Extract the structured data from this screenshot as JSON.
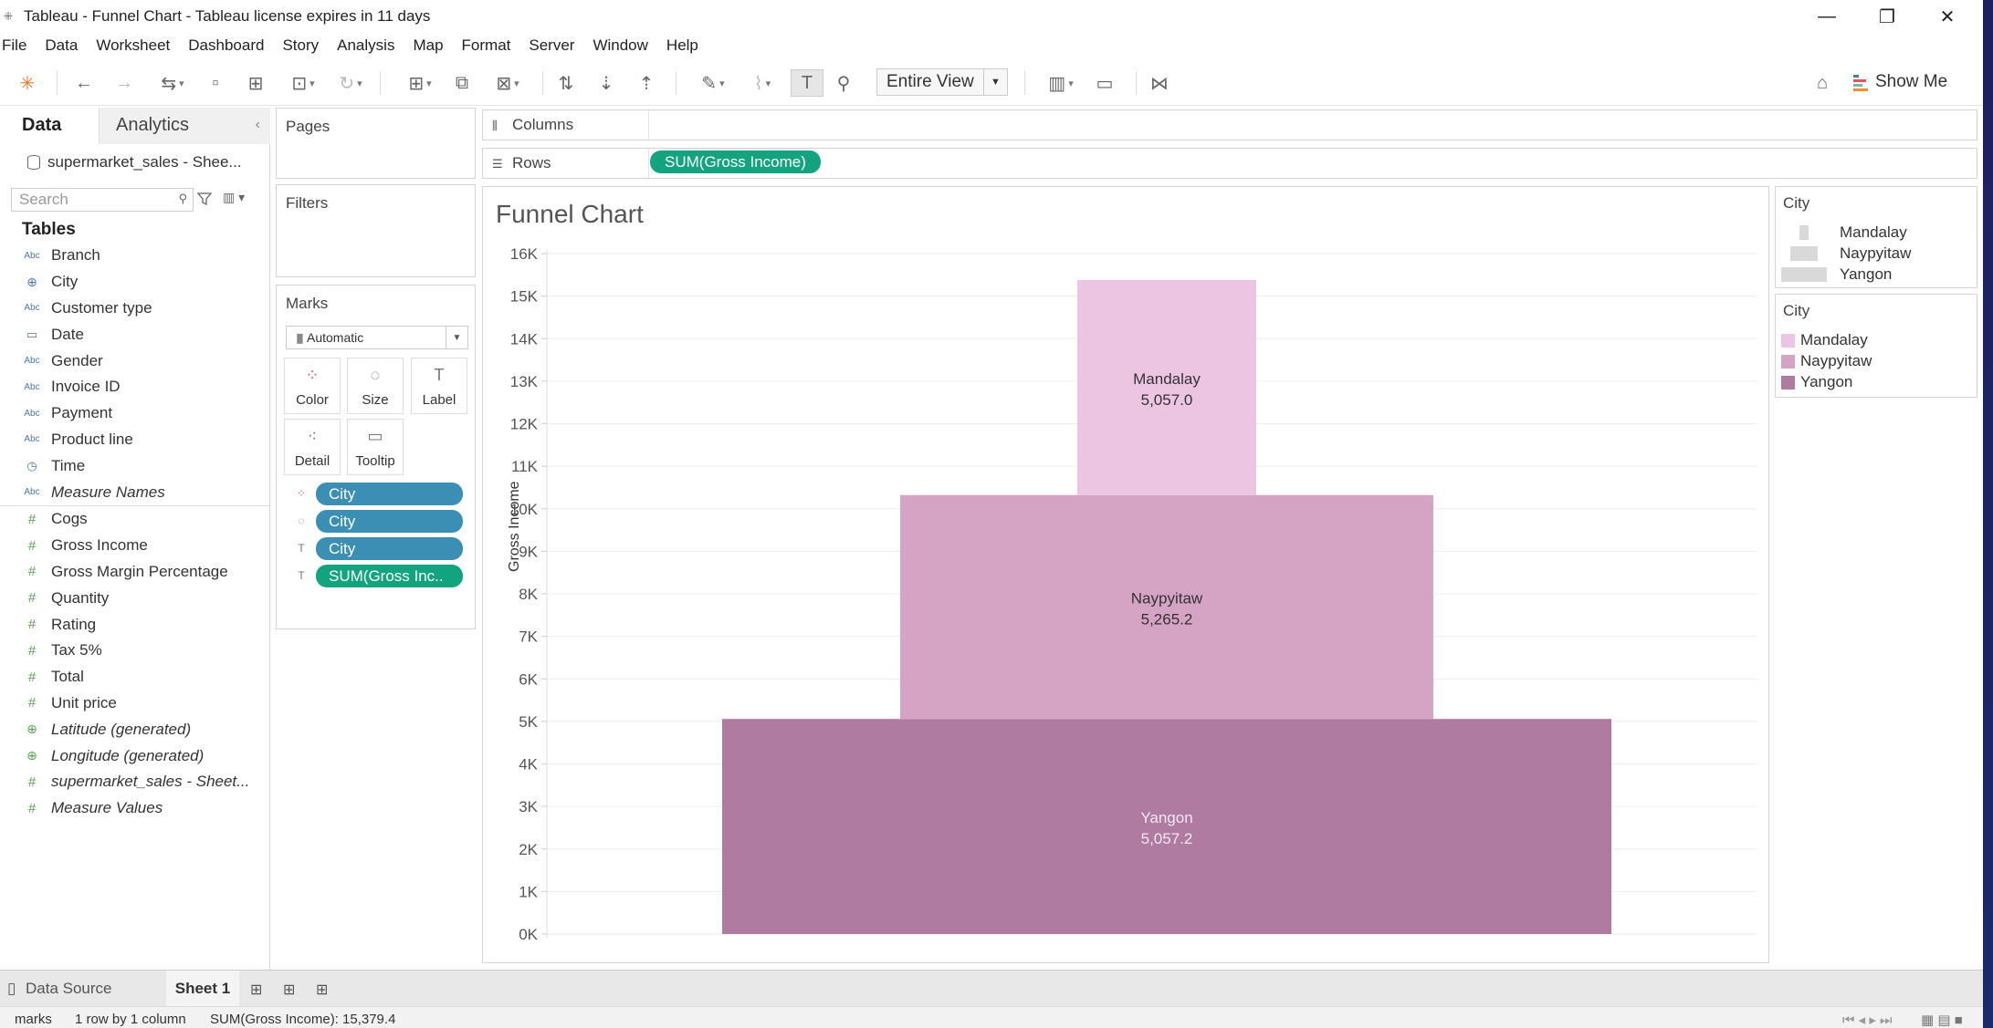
{
  "window": {
    "title": "Tableau - Funnel Chart - Tableau license expires in 11 days"
  },
  "menu": [
    "File",
    "Data",
    "Worksheet",
    "Dashboard",
    "Story",
    "Analysis",
    "Map",
    "Format",
    "Server",
    "Window",
    "Help"
  ],
  "toolbar": {
    "fit_select": "Entire View",
    "show_me": "Show Me"
  },
  "data_pane": {
    "tabs": [
      "Data",
      "Analytics"
    ],
    "datasource": "supermarket_sales - Shee...",
    "search_placeholder": "Search",
    "tables_heading": "Tables",
    "dimensions": [
      {
        "icon": "abc-icon",
        "glyph": "Abc",
        "label": "Branch",
        "italic": false
      },
      {
        "icon": "globe-icon",
        "glyph": "⊕",
        "label": "City",
        "italic": false
      },
      {
        "icon": "abc-icon",
        "glyph": "Abc",
        "label": "Customer type",
        "italic": false
      },
      {
        "icon": "calendar-icon",
        "glyph": "▭",
        "label": "Date",
        "italic": false
      },
      {
        "icon": "abc-icon",
        "glyph": "Abc",
        "label": "Gender",
        "italic": false
      },
      {
        "icon": "abc-icon",
        "glyph": "Abc",
        "label": "Invoice ID",
        "italic": false
      },
      {
        "icon": "abc-icon",
        "glyph": "Abc",
        "label": "Payment",
        "italic": false
      },
      {
        "icon": "abc-icon",
        "glyph": "Abc",
        "label": "Product line",
        "italic": false
      },
      {
        "icon": "clock-icon",
        "glyph": "◷",
        "label": "Time",
        "italic": false
      },
      {
        "icon": "abc-icon",
        "glyph": "Abc",
        "label": "Measure Names",
        "italic": true
      }
    ],
    "measures": [
      {
        "icon": "number-icon",
        "glyph": "#",
        "label": "Cogs",
        "italic": false
      },
      {
        "icon": "number-icon",
        "glyph": "#",
        "label": "Gross Income",
        "italic": false
      },
      {
        "icon": "number-icon",
        "glyph": "#",
        "label": "Gross Margin Percentage",
        "italic": false
      },
      {
        "icon": "number-icon",
        "glyph": "#",
        "label": "Quantity",
        "italic": false
      },
      {
        "icon": "number-icon",
        "glyph": "#",
        "label": "Rating",
        "italic": false
      },
      {
        "icon": "number-icon",
        "glyph": "#",
        "label": "Tax 5%",
        "italic": false
      },
      {
        "icon": "number-icon",
        "glyph": "#",
        "label": "Total",
        "italic": false
      },
      {
        "icon": "number-icon",
        "glyph": "#",
        "label": "Unit price",
        "italic": false
      },
      {
        "icon": "globe-icon",
        "glyph": "⊕",
        "label": "Latitude (generated)",
        "italic": true
      },
      {
        "icon": "globe-icon",
        "glyph": "⊕",
        "label": "Longitude (generated)",
        "italic": true
      },
      {
        "icon": "number-icon",
        "glyph": "#",
        "label": "supermarket_sales - Sheet...",
        "italic": true
      },
      {
        "icon": "number-icon",
        "glyph": "#",
        "label": "Measure Values",
        "italic": true
      }
    ]
  },
  "cards": {
    "pages": "Pages",
    "filters": "Filters",
    "marks": "Marks",
    "mark_type": "Automatic",
    "mark_buttons": [
      "Color",
      "Size",
      "Label",
      "Detail",
      "Tooltip"
    ],
    "mark_pills": [
      {
        "label": "City",
        "kind": "dim",
        "icon": "color-icon"
      },
      {
        "label": "City",
        "kind": "dim",
        "icon": "size-icon"
      },
      {
        "label": "City",
        "kind": "dim",
        "icon": "label-icon"
      },
      {
        "label": "SUM(Gross Inc..",
        "kind": "meas",
        "icon": "label-icon"
      }
    ]
  },
  "shelves": {
    "columns": "Columns",
    "rows": "Rows",
    "rows_pill": "SUM(Gross Income)"
  },
  "chart_data": {
    "type": "bar",
    "title": "Funnel Chart",
    "ylabel": "Gross Income",
    "xlabel": "",
    "ylim": [
      0,
      16000
    ],
    "ytick_labels": [
      "0K",
      "1K",
      "2K",
      "3K",
      "4K",
      "5K",
      "6K",
      "7K",
      "8K",
      "9K",
      "10K",
      "11K",
      "12K",
      "13K",
      "14K",
      "15K",
      "16K"
    ],
    "stacked": true,
    "grid": true,
    "series": [
      {
        "name": "Mandalay",
        "value": 5057.0,
        "label": "5,057.0",
        "width_rank": 1,
        "color": "#ecc5e2"
      },
      {
        "name": "Naypyitaw",
        "value": 5265.2,
        "label": "5,265.2",
        "width_rank": 2,
        "color": "#d5a3c4"
      },
      {
        "name": "Yangon",
        "value": 5057.2,
        "label": "5,057.2",
        "width_rank": 3,
        "color": "#b07ba0"
      }
    ]
  },
  "legends": {
    "size_title": "City",
    "size_items": [
      "Mandalay",
      "Naypyitaw",
      "Yangon"
    ],
    "color_title": "City",
    "color_items": [
      {
        "label": "Mandalay",
        "color": "#ecc5e2"
      },
      {
        "label": "Naypyitaw",
        "color": "#d5a3c4"
      },
      {
        "label": "Yangon",
        "color": "#b07ba0"
      }
    ]
  },
  "tabs": {
    "data_source": "Data Source",
    "sheet": "Sheet 1"
  },
  "status": {
    "marks": "marks",
    "dims": "1 row by 1 column",
    "sum": "SUM(Gross Income): 15,379.4"
  }
}
